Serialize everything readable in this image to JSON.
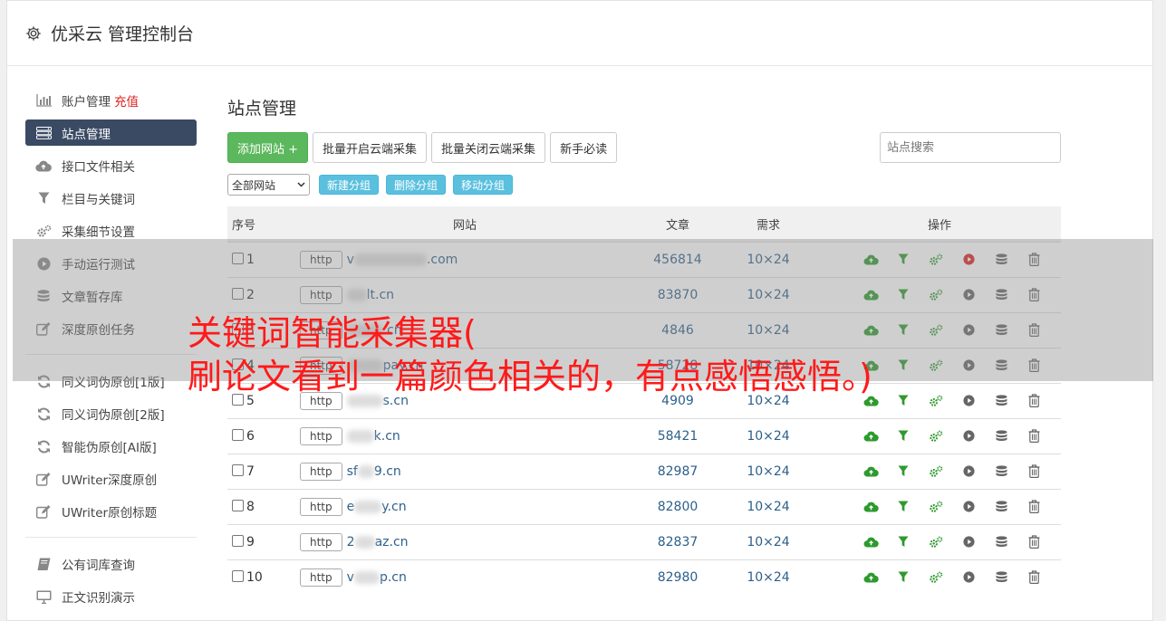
{
  "header": {
    "title": "优采云 管理控制台",
    "icon": "gear-icon"
  },
  "sidebar": {
    "groups": [
      [
        {
          "label": "账户管理",
          "extra": "充值",
          "icon": "bar-chart-icon",
          "active": false
        },
        {
          "label": "站点管理",
          "icon": "server-icon",
          "active": true
        },
        {
          "label": "接口文件相关",
          "icon": "cloud-upload-icon",
          "active": false
        },
        {
          "label": "栏目与关键词",
          "icon": "filter-icon",
          "active": false
        },
        {
          "label": "采集细节设置",
          "icon": "gears-icon",
          "active": false
        },
        {
          "label": "手动运行测试",
          "icon": "play-circle-icon",
          "active": false
        },
        {
          "label": "文章暂存库",
          "icon": "database-icon",
          "active": false
        },
        {
          "label": "深度原创任务",
          "icon": "edit-icon",
          "active": false
        }
      ],
      [
        {
          "label": "同义词伪原创[1版]",
          "icon": "refresh-icon",
          "active": false
        },
        {
          "label": "同义词伪原创[2版]",
          "icon": "refresh-icon",
          "active": false
        },
        {
          "label": "智能伪原创[AI版]",
          "icon": "refresh-icon",
          "active": false
        },
        {
          "label": "UWriter深度原创",
          "icon": "edit-icon",
          "active": false
        },
        {
          "label": "UWriter原创标题",
          "icon": "edit-icon",
          "active": false
        }
      ],
      [
        {
          "label": "公有词库查询",
          "icon": "book-icon",
          "active": false
        },
        {
          "label": "正文识别演示",
          "icon": "monitor-icon",
          "active": false
        }
      ]
    ]
  },
  "main": {
    "title": "站点管理",
    "add_site": "添加网站 +",
    "batch_open": "批量开启云端采集",
    "batch_close": "批量关闭云端采集",
    "guide": "新手必读",
    "search_placeholder": "站点搜索",
    "group_select": "全部网站",
    "new_group": "新建分组",
    "delete_group": "删除分组",
    "move_group": "移动分组"
  },
  "table": {
    "headers": {
      "no": "序号",
      "site": "网站",
      "articles": "文章",
      "demand": "需求",
      "ops": "操作"
    },
    "rows": [
      {
        "no": "1",
        "protocol": "http",
        "pre": "v",
        "suf": ".com",
        "articles": "456814",
        "demand": "10×24",
        "active": true,
        "blurW": 80
      },
      {
        "no": "2",
        "protocol": "http",
        "pre": "",
        "suf": "lt.cn",
        "articles": "83870",
        "demand": "10×24",
        "active": false,
        "blurW": 22
      },
      {
        "no": "3",
        "protocol": "http",
        "pre": "",
        "suf": ".cn",
        "articles": "4846",
        "demand": "10×24",
        "active": false,
        "blurW": 40
      },
      {
        "no": "4",
        "protocol": "http",
        "pre": "",
        "suf": "pay.cn",
        "articles": "58728",
        "demand": "10×24",
        "active": false,
        "blurW": 40
      },
      {
        "no": "5",
        "protocol": "http",
        "pre": "",
        "suf": "s.cn",
        "articles": "4909",
        "demand": "10×24",
        "active": false,
        "blurW": 40
      },
      {
        "no": "6",
        "protocol": "http",
        "pre": "",
        "suf": "k.cn",
        "articles": "58421",
        "demand": "10×24",
        "active": false,
        "blurW": 30
      },
      {
        "no": "7",
        "protocol": "http",
        "pre": "sf",
        "suf": "9.cn",
        "articles": "82987",
        "demand": "10×24",
        "active": false,
        "blurW": 18
      },
      {
        "no": "8",
        "protocol": "http",
        "pre": "e",
        "suf": "y.cn",
        "articles": "82800",
        "demand": "10×24",
        "active": false,
        "blurW": 30
      },
      {
        "no": "9",
        "protocol": "http",
        "pre": "2",
        "suf": "az.cn",
        "articles": "82837",
        "demand": "10×24",
        "active": false,
        "blurW": 22
      },
      {
        "no": "10",
        "protocol": "http",
        "pre": "v",
        "suf": "p.cn",
        "articles": "82980",
        "demand": "10×24",
        "active": false,
        "blurW": 28
      }
    ]
  },
  "overlay": {
    "line1": "关键词智能采集器(",
    "line2": "刷论文看到一篇颜色相关的，有点感悟感悟。)"
  },
  "colors": {
    "accent_green": "#5cb85c",
    "accent_blue": "#5bc0de",
    "sidebar_active": "#3a4a63",
    "overlay_text": "#ff1a1a",
    "link": "#2c5f8a"
  }
}
